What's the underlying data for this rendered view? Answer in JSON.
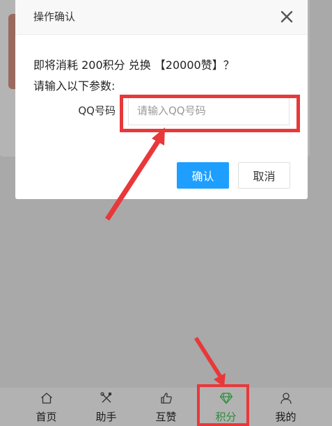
{
  "dialog": {
    "title": "操作确认",
    "message_line1": "即将消耗 200积分 兑换 【20000赞】？",
    "message_line2": "请输入以下参数:",
    "field_label": "QQ号码",
    "field_placeholder": "请输入QQ号码",
    "field_value": "",
    "confirm_label": "确认",
    "cancel_label": "取消"
  },
  "nav": {
    "items": [
      {
        "label": "首页",
        "icon": "home-icon"
      },
      {
        "label": "助手",
        "icon": "tools-icon"
      },
      {
        "label": "互赞",
        "icon": "thumbs-up-icon"
      },
      {
        "label": "积分",
        "icon": "diamond-icon",
        "active": true
      },
      {
        "label": "我的",
        "icon": "user-icon"
      }
    ]
  },
  "colors": {
    "accent": "#1e9fff",
    "active_nav": "#2e8b3d",
    "annotation": "#e8383a",
    "overlay": "#a9a9a9"
  }
}
